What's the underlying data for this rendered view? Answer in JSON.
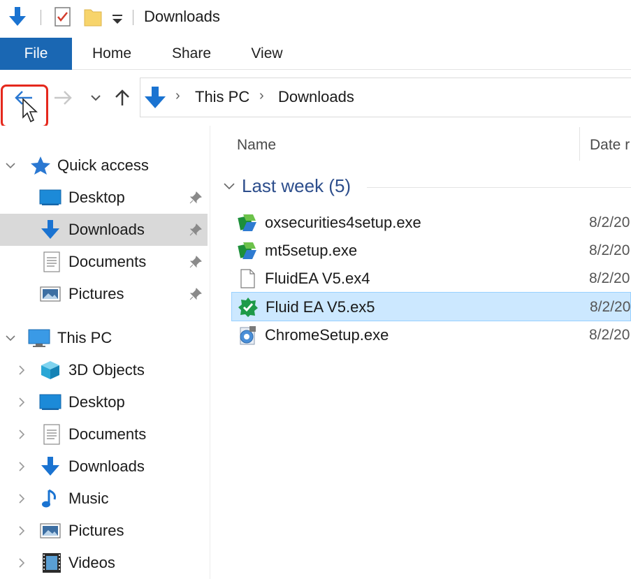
{
  "window": {
    "title": "Downloads"
  },
  "ribbon": {
    "tabs": [
      "File",
      "Home",
      "Share",
      "View"
    ]
  },
  "address": {
    "crumbs": [
      "This PC",
      "Downloads"
    ]
  },
  "sidebar": {
    "quick_access": {
      "label": "Quick access",
      "items": [
        {
          "label": "Desktop",
          "icon": "desktop-icon",
          "pinned": true
        },
        {
          "label": "Downloads",
          "icon": "downloads-icon",
          "pinned": true,
          "selected": true
        },
        {
          "label": "Documents",
          "icon": "documents-icon",
          "pinned": true
        },
        {
          "label": "Pictures",
          "icon": "pictures-icon",
          "pinned": true
        }
      ]
    },
    "this_pc": {
      "label": "This PC",
      "items": [
        {
          "label": "3D Objects",
          "icon": "3d-objects-icon"
        },
        {
          "label": "Desktop",
          "icon": "desktop-icon"
        },
        {
          "label": "Documents",
          "icon": "documents-icon"
        },
        {
          "label": "Downloads",
          "icon": "downloads-icon"
        },
        {
          "label": "Music",
          "icon": "music-icon"
        },
        {
          "label": "Pictures",
          "icon": "pictures-icon"
        },
        {
          "label": "Videos",
          "icon": "videos-icon"
        }
      ]
    }
  },
  "content": {
    "columns": {
      "name": "Name",
      "date": "Date r"
    },
    "group": "Last week (5)",
    "files": [
      {
        "name": "oxsecurities4setup.exe",
        "date": "8/2/20",
        "icon": "installer-icon"
      },
      {
        "name": "mt5setup.exe",
        "date": "8/2/20",
        "icon": "installer-icon"
      },
      {
        "name": "FluidEA V5.ex4",
        "date": "8/2/20",
        "icon": "blank-file-icon"
      },
      {
        "name": "Fluid EA V5.ex5",
        "date": "8/2/20",
        "icon": "expert-advisor-icon",
        "selected": true
      },
      {
        "name": "ChromeSetup.exe",
        "date": "8/2/20",
        "icon": "chrome-setup-icon"
      }
    ]
  },
  "colors": {
    "accent": "#1a67b3",
    "selected_row": "#cce8ff",
    "highlight": "#e5281c",
    "group_label": "#2d4e8c"
  }
}
